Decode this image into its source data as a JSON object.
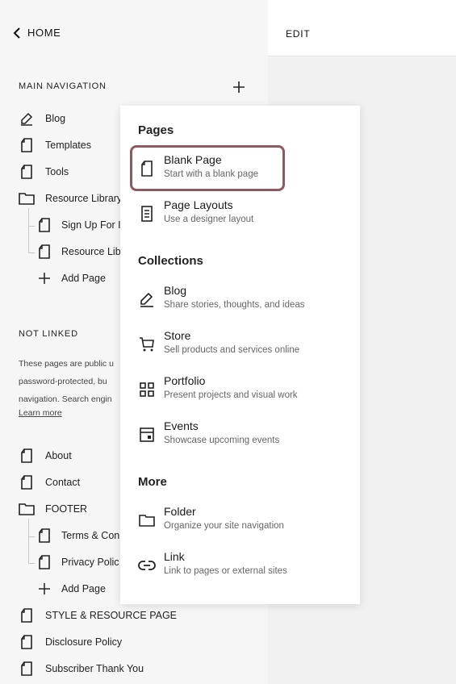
{
  "left_panel": {
    "home_label": "HOME",
    "main_nav_label": "MAIN NAVIGATION",
    "main_items": [
      {
        "label": "Blog",
        "icon": "blog-pen-icon"
      },
      {
        "label": "Templates",
        "icon": "page-icon"
      },
      {
        "label": "Tools",
        "icon": "page-icon"
      },
      {
        "label": "Resource Library",
        "icon": "folder-icon"
      }
    ],
    "main_children": [
      {
        "label": "Sign Up For I",
        "icon": "page-icon"
      },
      {
        "label": "Resource Lib",
        "icon": "page-icon"
      }
    ],
    "add_page_label": "Add Page",
    "not_linked_label": "NOT LINKED",
    "not_linked_text": [
      "These pages are public u",
      "password-protected, bu",
      "navigation. Search engin"
    ],
    "learn_more": "Learn more",
    "not_linked_items": [
      {
        "label": "About",
        "icon": "page-icon"
      },
      {
        "label": "Contact",
        "icon": "page-icon"
      },
      {
        "label": "FOOTER",
        "icon": "folder-icon"
      }
    ],
    "footer_children": [
      {
        "label": "Terms & Con",
        "icon": "page-icon"
      },
      {
        "label": "Privacy Polic",
        "icon": "page-icon"
      }
    ],
    "add_page_label_2": "Add Page",
    "bottom_items": [
      {
        "label": "STYLE & RESOURCE PAGE",
        "icon": "page-icon"
      },
      {
        "label": "Disclosure Policy",
        "icon": "page-icon"
      },
      {
        "label": "Subscriber Thank You",
        "icon": "page-icon"
      }
    ]
  },
  "header": {
    "edit_label": "EDIT"
  },
  "popup": {
    "sections": [
      {
        "title": "Pages",
        "items": [
          {
            "title": "Blank Page",
            "subtitle": "Start with a blank page",
            "icon": "page-icon"
          },
          {
            "title": "Page Layouts",
            "subtitle": "Use a designer layout",
            "icon": "layout-icon"
          }
        ]
      },
      {
        "title": "Collections",
        "items": [
          {
            "title": "Blog",
            "subtitle": "Share stories, thoughts, and ideas",
            "icon": "blog-pen-icon"
          },
          {
            "title": "Store",
            "subtitle": "Sell products and services online",
            "icon": "cart-icon"
          },
          {
            "title": "Portfolio",
            "subtitle": "Present projects and visual work",
            "icon": "grid-icon"
          },
          {
            "title": "Events",
            "subtitle": "Showcase upcoming events",
            "icon": "calendar-icon"
          }
        ]
      },
      {
        "title": "More",
        "items": [
          {
            "title": "Folder",
            "subtitle": "Organize your site navigation",
            "icon": "folder-icon"
          },
          {
            "title": "Link",
            "subtitle": "Link to pages or external sites",
            "icon": "link-icon"
          }
        ]
      }
    ],
    "highlight_color": "#8f5a5f"
  }
}
